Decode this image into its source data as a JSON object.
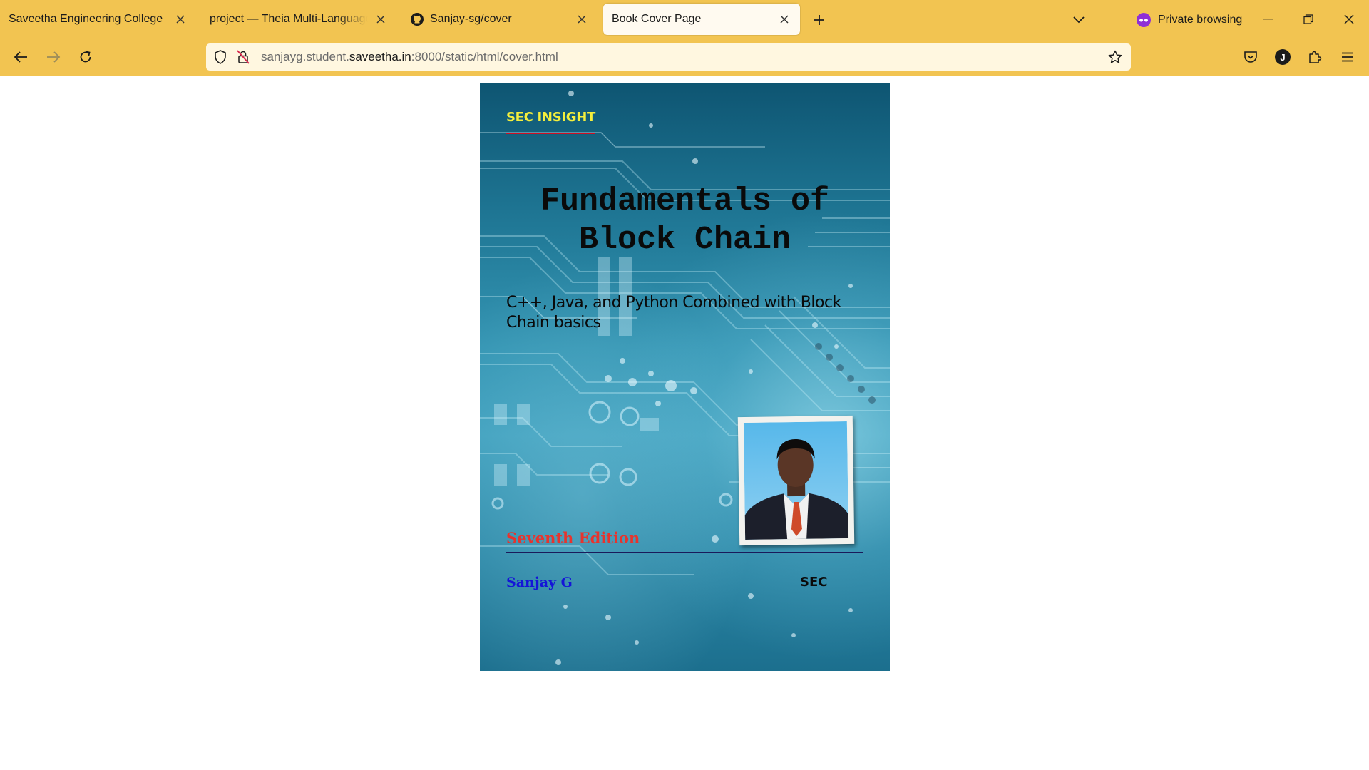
{
  "browser": {
    "tabs": [
      {
        "title": "Saveetha Engineering College",
        "active": false
      },
      {
        "title": "project — Theia Multi-Language Ex",
        "active": false
      },
      {
        "title": "Sanjay-sg/cover",
        "active": false,
        "favicon": "github-icon"
      },
      {
        "title": "Book Cover Page",
        "active": true
      }
    ],
    "private_label": "Private browsing",
    "url": {
      "prefix": "sanjayg.student.",
      "domain": "saveetha.in",
      "suffix": ":8000/static/html/cover.html"
    },
    "account_initial": "J",
    "colors": {
      "chrome": "#f2c451",
      "active_tab": "#fffaf0",
      "urlbar": "#fff7e0"
    }
  },
  "cover": {
    "brand": "SEC INSIGHT",
    "title": "Fundamentals of Block Chain",
    "subtitle": "C++, Java, and Python Combined with Block Chain basics",
    "edition": "Seventh Edition",
    "author": "Sanjay G",
    "publisher": "SEC",
    "colors": {
      "brand": "#f5ef3c",
      "brand_underline": "#d10d22",
      "edition": "#e8332d",
      "author": "#1414d8",
      "background": "#2b87a6"
    }
  }
}
